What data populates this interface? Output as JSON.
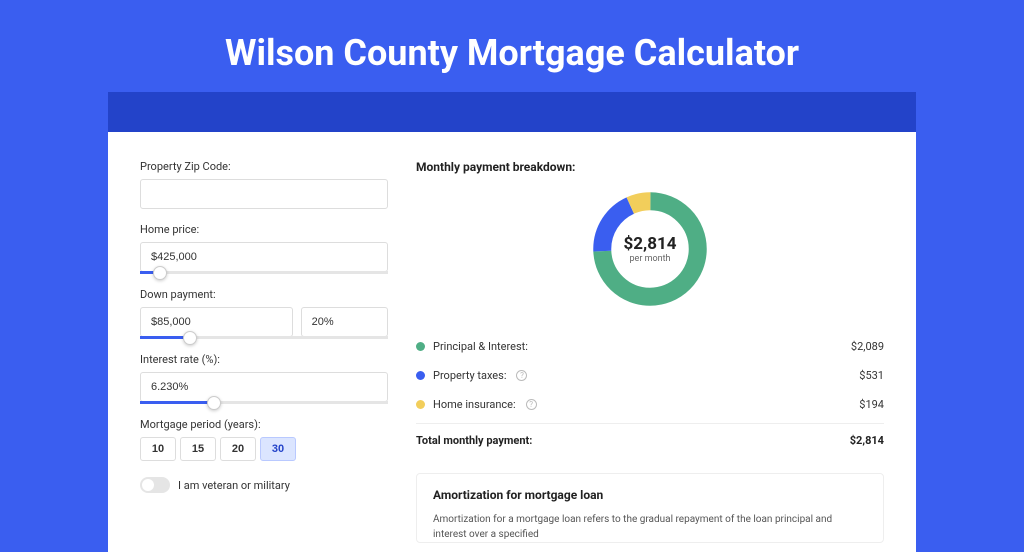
{
  "title": "Wilson County Mortgage Calculator",
  "form": {
    "zip_label": "Property Zip Code:",
    "zip_value": "",
    "home_price_label": "Home price:",
    "home_price_value": "$425,000",
    "home_price_slider_pct": 8,
    "down_payment_label": "Down payment:",
    "down_payment_value": "$85,000",
    "down_payment_pct": "20%",
    "down_payment_slider_pct": 20,
    "interest_label": "Interest rate (%):",
    "interest_value": "6.230%",
    "interest_slider_pct": 30,
    "period_label": "Mortgage period (years):",
    "periods": [
      "10",
      "15",
      "20",
      "30"
    ],
    "period_selected": "30",
    "veteran_label": "I am veteran or military"
  },
  "breakdown": {
    "title": "Monthly payment breakdown:",
    "donut_amount": "$2,814",
    "donut_sub": "per month",
    "items": [
      {
        "label": "Principal & Interest:",
        "value": "$2,089",
        "has_info": false
      },
      {
        "label": "Property taxes:",
        "value": "$531",
        "has_info": true
      },
      {
        "label": "Home insurance:",
        "value": "$194",
        "has_info": true
      }
    ],
    "total_label": "Total monthly payment:",
    "total_value": "$2,814"
  },
  "amortization": {
    "title": "Amortization for mortgage loan",
    "text": "Amortization for a mortgage loan refers to the gradual repayment of the loan principal and interest over a specified"
  },
  "chart_data": {
    "type": "pie",
    "title": "Monthly payment breakdown",
    "categories": [
      "Principal & Interest",
      "Property taxes",
      "Home insurance"
    ],
    "values": [
      2089,
      531,
      194
    ],
    "total": 2814,
    "colors": [
      "#4fae85",
      "#3a5ef0",
      "#f2ce5b"
    ]
  }
}
